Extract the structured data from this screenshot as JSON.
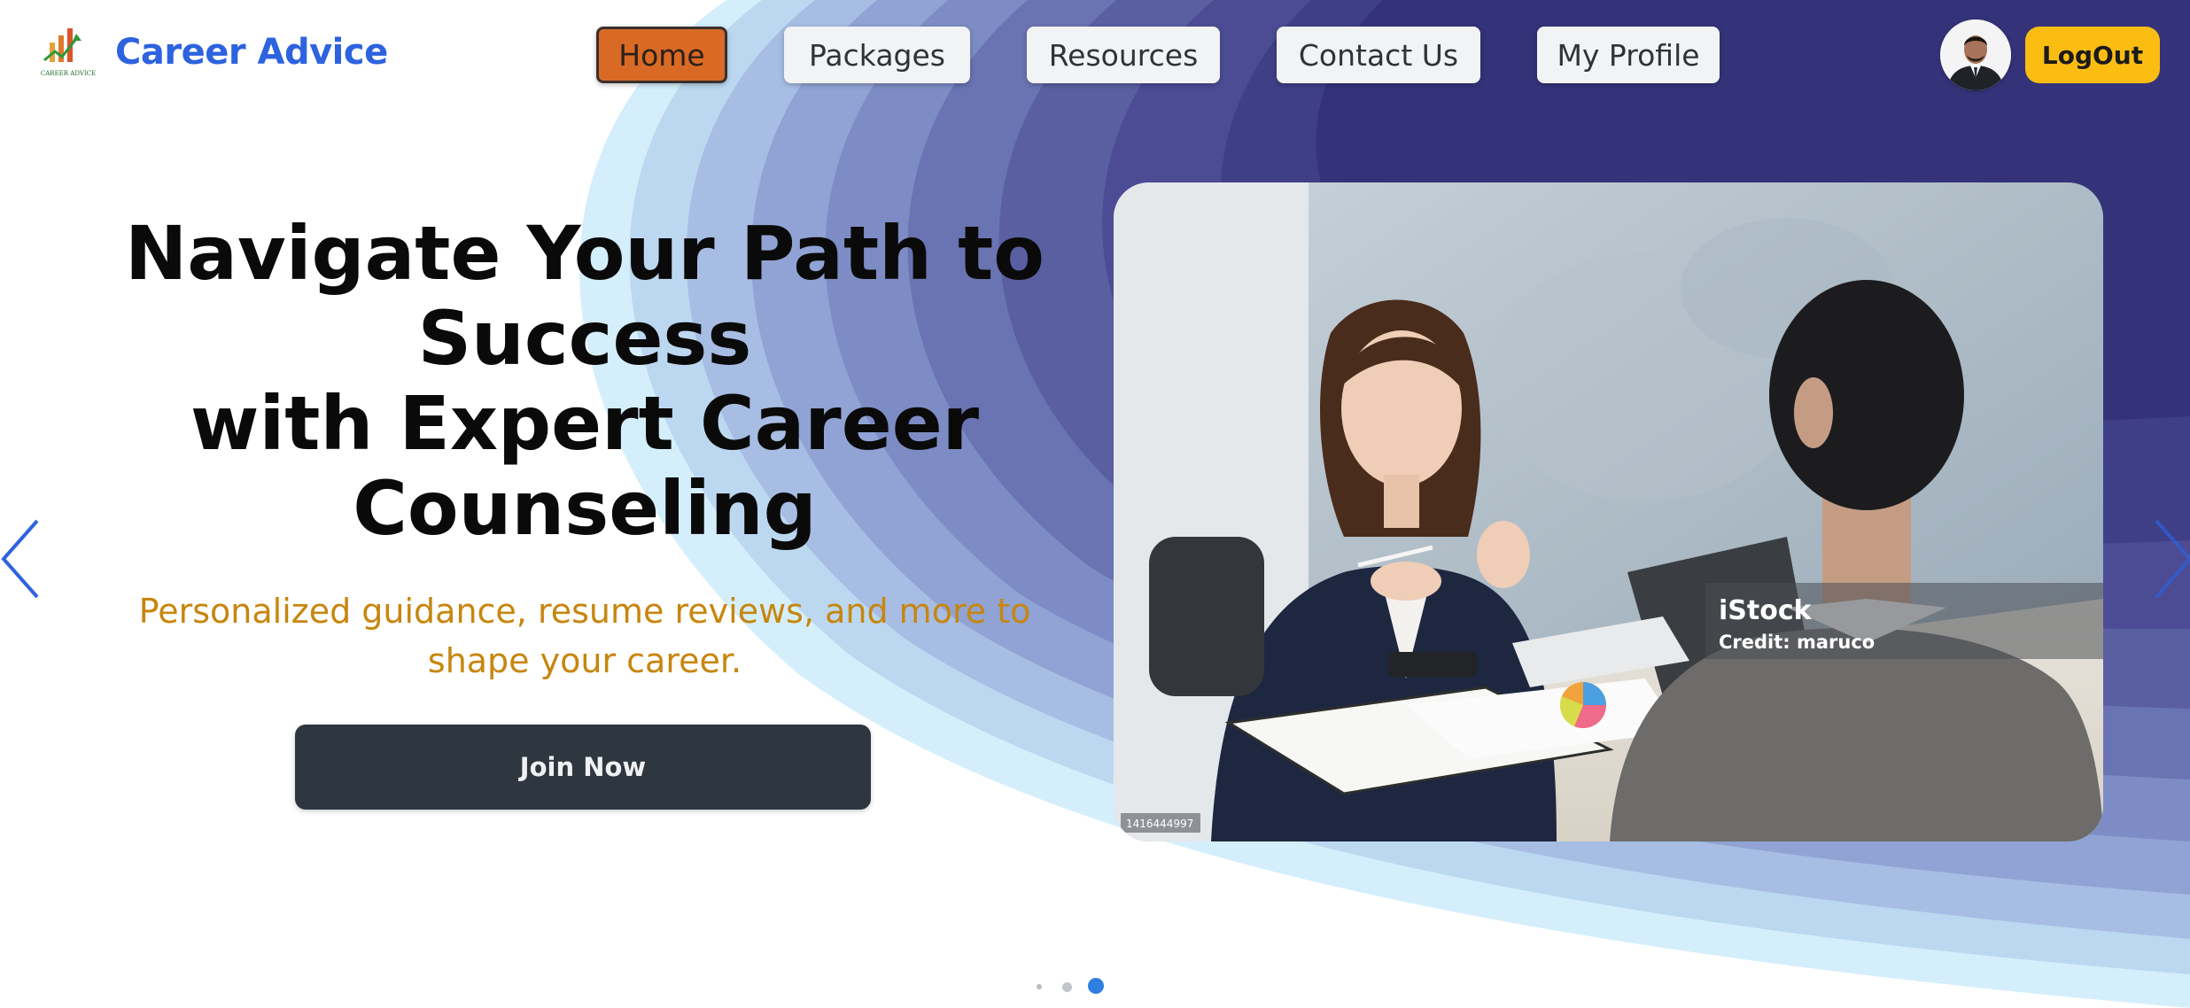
{
  "header": {
    "brand": "Career Advice",
    "logo_caption": "CAREER ADVICE",
    "nav": [
      {
        "label": "Home",
        "active": true
      },
      {
        "label": "Packages",
        "active": false
      },
      {
        "label": "Resources",
        "active": false
      },
      {
        "label": "Contact Us",
        "active": false
      },
      {
        "label": "My Profile",
        "active": false
      }
    ],
    "logout_label": "LogOut"
  },
  "hero": {
    "title_line1": "Navigate Your Path to",
    "title_line2": "Success",
    "title_line3": "with Expert Career",
    "title_line4": "Counseling",
    "subtitle_line1": "Personalized guidance, resume reviews, and more to",
    "subtitle_line2": "shape your career.",
    "cta_label": "Join Now"
  },
  "image": {
    "watermark_brand": "iStock",
    "watermark_credit": "Credit: maruco",
    "stock_id": "1416444997"
  },
  "carousel": {
    "slide_count": 3,
    "active_slide": 3
  },
  "colors": {
    "brand": "#2d63de",
    "active_nav": "#d96a26",
    "logout": "#fbbd12",
    "subtitle": "#c7860f",
    "cta": "#2e3640",
    "hero_dark": "#33327a"
  },
  "icons": {
    "prev": "chevron-left-icon",
    "next": "chevron-right-icon"
  }
}
